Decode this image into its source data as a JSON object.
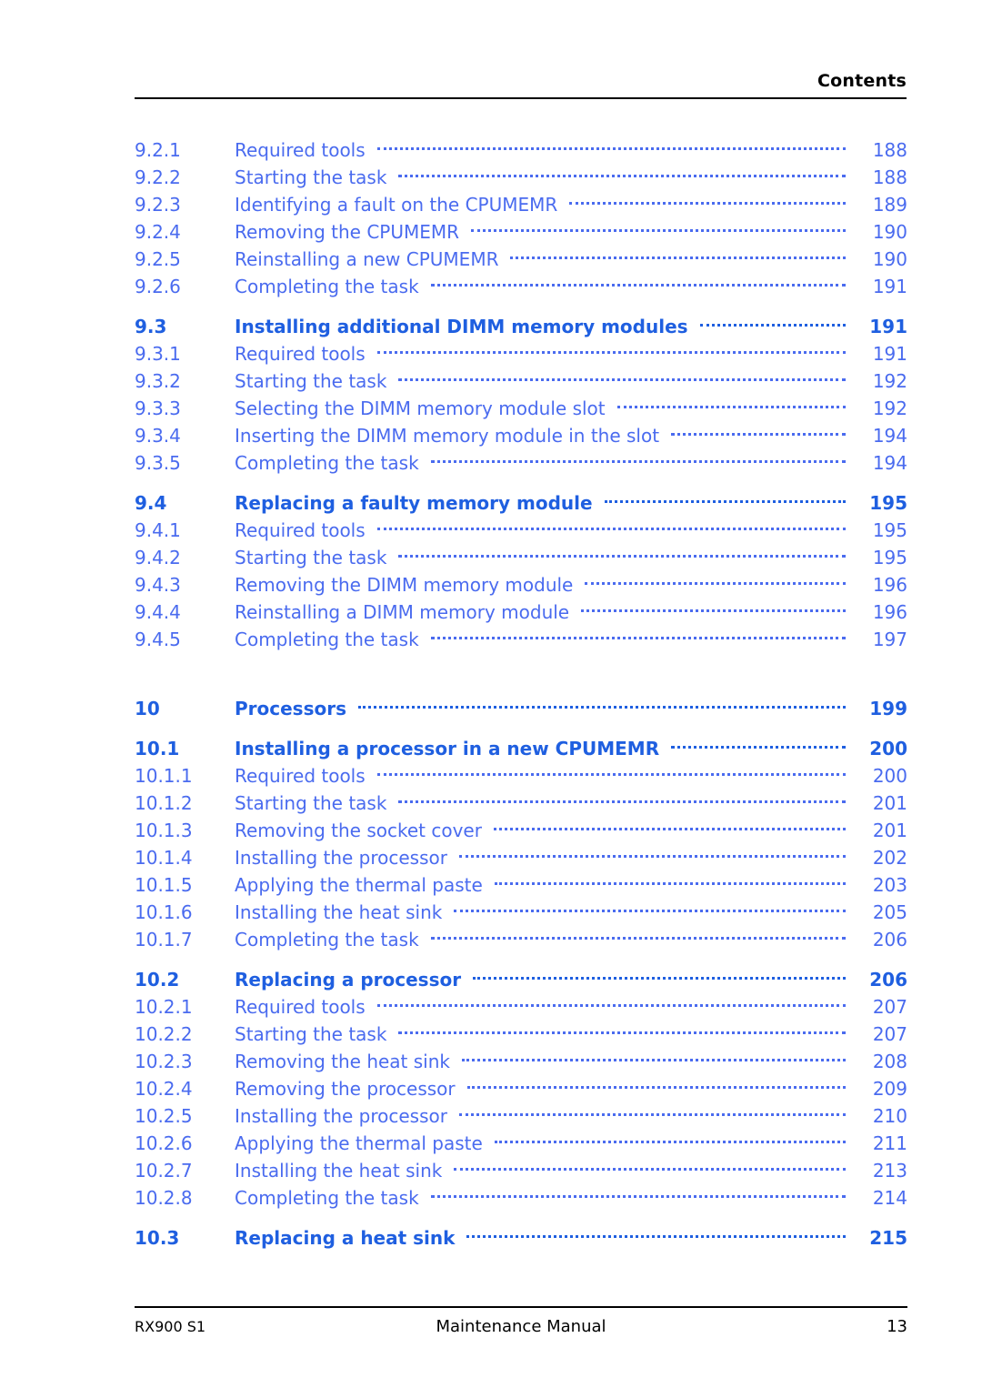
{
  "header": {
    "title": "Contents"
  },
  "toc": {
    "entries": [
      {
        "num": "9.2.1",
        "label": "Required tools",
        "page": "188",
        "level": "sub",
        "gap": ""
      },
      {
        "num": "9.2.2",
        "label": "Starting the task",
        "page": "188",
        "level": "sub",
        "gap": ""
      },
      {
        "num": "9.2.3",
        "label": "Identifying a fault on the CPUMEMR",
        "page": "189",
        "level": "sub",
        "gap": ""
      },
      {
        "num": "9.2.4",
        "label": "Removing the CPUMEMR",
        "page": "190",
        "level": "sub",
        "gap": ""
      },
      {
        "num": "9.2.5",
        "label": "Reinstalling a new CPUMEMR",
        "page": "190",
        "level": "sub",
        "gap": ""
      },
      {
        "num": "9.2.6",
        "label": "Completing the task",
        "page": "191",
        "level": "sub",
        "gap": ""
      },
      {
        "num": "9.3",
        "label": "Installing additional DIMM memory modules",
        "page": "191",
        "level": "major",
        "gap": "spacer-top"
      },
      {
        "num": "9.3.1",
        "label": "Required tools",
        "page": "191",
        "level": "sub",
        "gap": ""
      },
      {
        "num": "9.3.2",
        "label": "Starting the task",
        "page": "192",
        "level": "sub",
        "gap": ""
      },
      {
        "num": "9.3.3",
        "label": "Selecting the DIMM memory module slot",
        "page": "192",
        "level": "sub",
        "gap": ""
      },
      {
        "num": "9.3.4",
        "label": "Inserting the DIMM memory module in the slot",
        "page": "194",
        "level": "sub",
        "gap": ""
      },
      {
        "num": "9.3.5",
        "label": "Completing the task",
        "page": "194",
        "level": "sub",
        "gap": ""
      },
      {
        "num": "9.4",
        "label": "Replacing a faulty memory module",
        "page": "195",
        "level": "major",
        "gap": "spacer-top"
      },
      {
        "num": "9.4.1",
        "label": "Required tools",
        "page": "195",
        "level": "sub",
        "gap": ""
      },
      {
        "num": "9.4.2",
        "label": "Starting the task",
        "page": "195",
        "level": "sub",
        "gap": ""
      },
      {
        "num": "9.4.3",
        "label": "Removing the DIMM memory module",
        "page": "196",
        "level": "sub",
        "gap": ""
      },
      {
        "num": "9.4.4",
        "label": "Reinstalling a DIMM memory module",
        "page": "196",
        "level": "sub",
        "gap": ""
      },
      {
        "num": "9.4.5",
        "label": "Completing the task",
        "page": "197",
        "level": "sub",
        "gap": ""
      },
      {
        "num": "10",
        "label": "Processors",
        "page": "199",
        "level": "major",
        "gap": "spacer-big"
      },
      {
        "num": "10.1",
        "label": "Installing a processor in a new CPUMEMR",
        "page": "200",
        "level": "major",
        "gap": "spacer-top"
      },
      {
        "num": "10.1.1",
        "label": "Required tools",
        "page": "200",
        "level": "sub",
        "gap": ""
      },
      {
        "num": "10.1.2",
        "label": "Starting the task",
        "page": "201",
        "level": "sub",
        "gap": ""
      },
      {
        "num": "10.1.3",
        "label": "Removing the socket cover",
        "page": "201",
        "level": "sub",
        "gap": ""
      },
      {
        "num": "10.1.4",
        "label": "Installing the processor",
        "page": "202",
        "level": "sub",
        "gap": ""
      },
      {
        "num": "10.1.5",
        "label": "Applying the thermal paste",
        "page": "203",
        "level": "sub",
        "gap": ""
      },
      {
        "num": "10.1.6",
        "label": "Installing the heat sink",
        "page": "205",
        "level": "sub",
        "gap": ""
      },
      {
        "num": "10.1.7",
        "label": "Completing the task",
        "page": "206",
        "level": "sub",
        "gap": ""
      },
      {
        "num": "10.2",
        "label": "Replacing a processor",
        "page": "206",
        "level": "major",
        "gap": "spacer-top"
      },
      {
        "num": "10.2.1",
        "label": "Required tools",
        "page": "207",
        "level": "sub",
        "gap": ""
      },
      {
        "num": "10.2.2",
        "label": "Starting the task",
        "page": "207",
        "level": "sub",
        "gap": ""
      },
      {
        "num": "10.2.3",
        "label": "Removing the heat sink",
        "page": "208",
        "level": "sub",
        "gap": ""
      },
      {
        "num": "10.2.4",
        "label": "Removing the processor",
        "page": "209",
        "level": "sub",
        "gap": ""
      },
      {
        "num": "10.2.5",
        "label": "Installing the processor",
        "page": "210",
        "level": "sub",
        "gap": ""
      },
      {
        "num": "10.2.6",
        "label": "Applying the thermal paste",
        "page": "211",
        "level": "sub",
        "gap": ""
      },
      {
        "num": "10.2.7",
        "label": "Installing the heat sink",
        "page": "213",
        "level": "sub",
        "gap": ""
      },
      {
        "num": "10.2.8",
        "label": "Completing the task",
        "page": "214",
        "level": "sub",
        "gap": ""
      },
      {
        "num": "10.3",
        "label": "Replacing a heat sink",
        "page": "215",
        "level": "major",
        "gap": "spacer-top"
      }
    ]
  },
  "footer": {
    "left": "RX900 S1",
    "center": "Maintenance Manual",
    "right": "13"
  },
  "colors": {
    "link": "#4A6BEF",
    "link_major": "#1F5FE0",
    "text": "#000000"
  }
}
